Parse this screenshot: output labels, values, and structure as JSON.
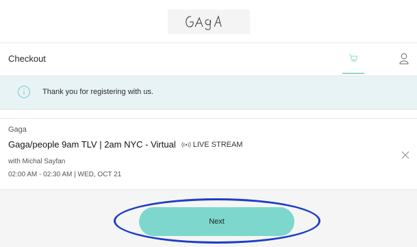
{
  "brand": {
    "logo_text": "GAGA"
  },
  "topbar": {
    "title": "Checkout",
    "cart_icon": "cart-icon",
    "user_icon": "user-icon",
    "accent_color": "#8fd6cf"
  },
  "notice": {
    "icon": "info-icon",
    "text": "Thank you for registering with us."
  },
  "cart_item": {
    "studio": "Gaga",
    "title": "Gaga/people 9am TLV | 2am NYC - Virtual",
    "live_icon": "live-stream-icon",
    "live_label": "LIVE STREAM",
    "instructor": "with Michal Sayfan",
    "time": "02:00 AM - 02:30 AM | WED, OCT 21",
    "remove_icon": "close-icon"
  },
  "footer": {
    "next_label": "Next",
    "button_color": "#7ed7cc",
    "annotation_color": "#1b3dc7"
  }
}
